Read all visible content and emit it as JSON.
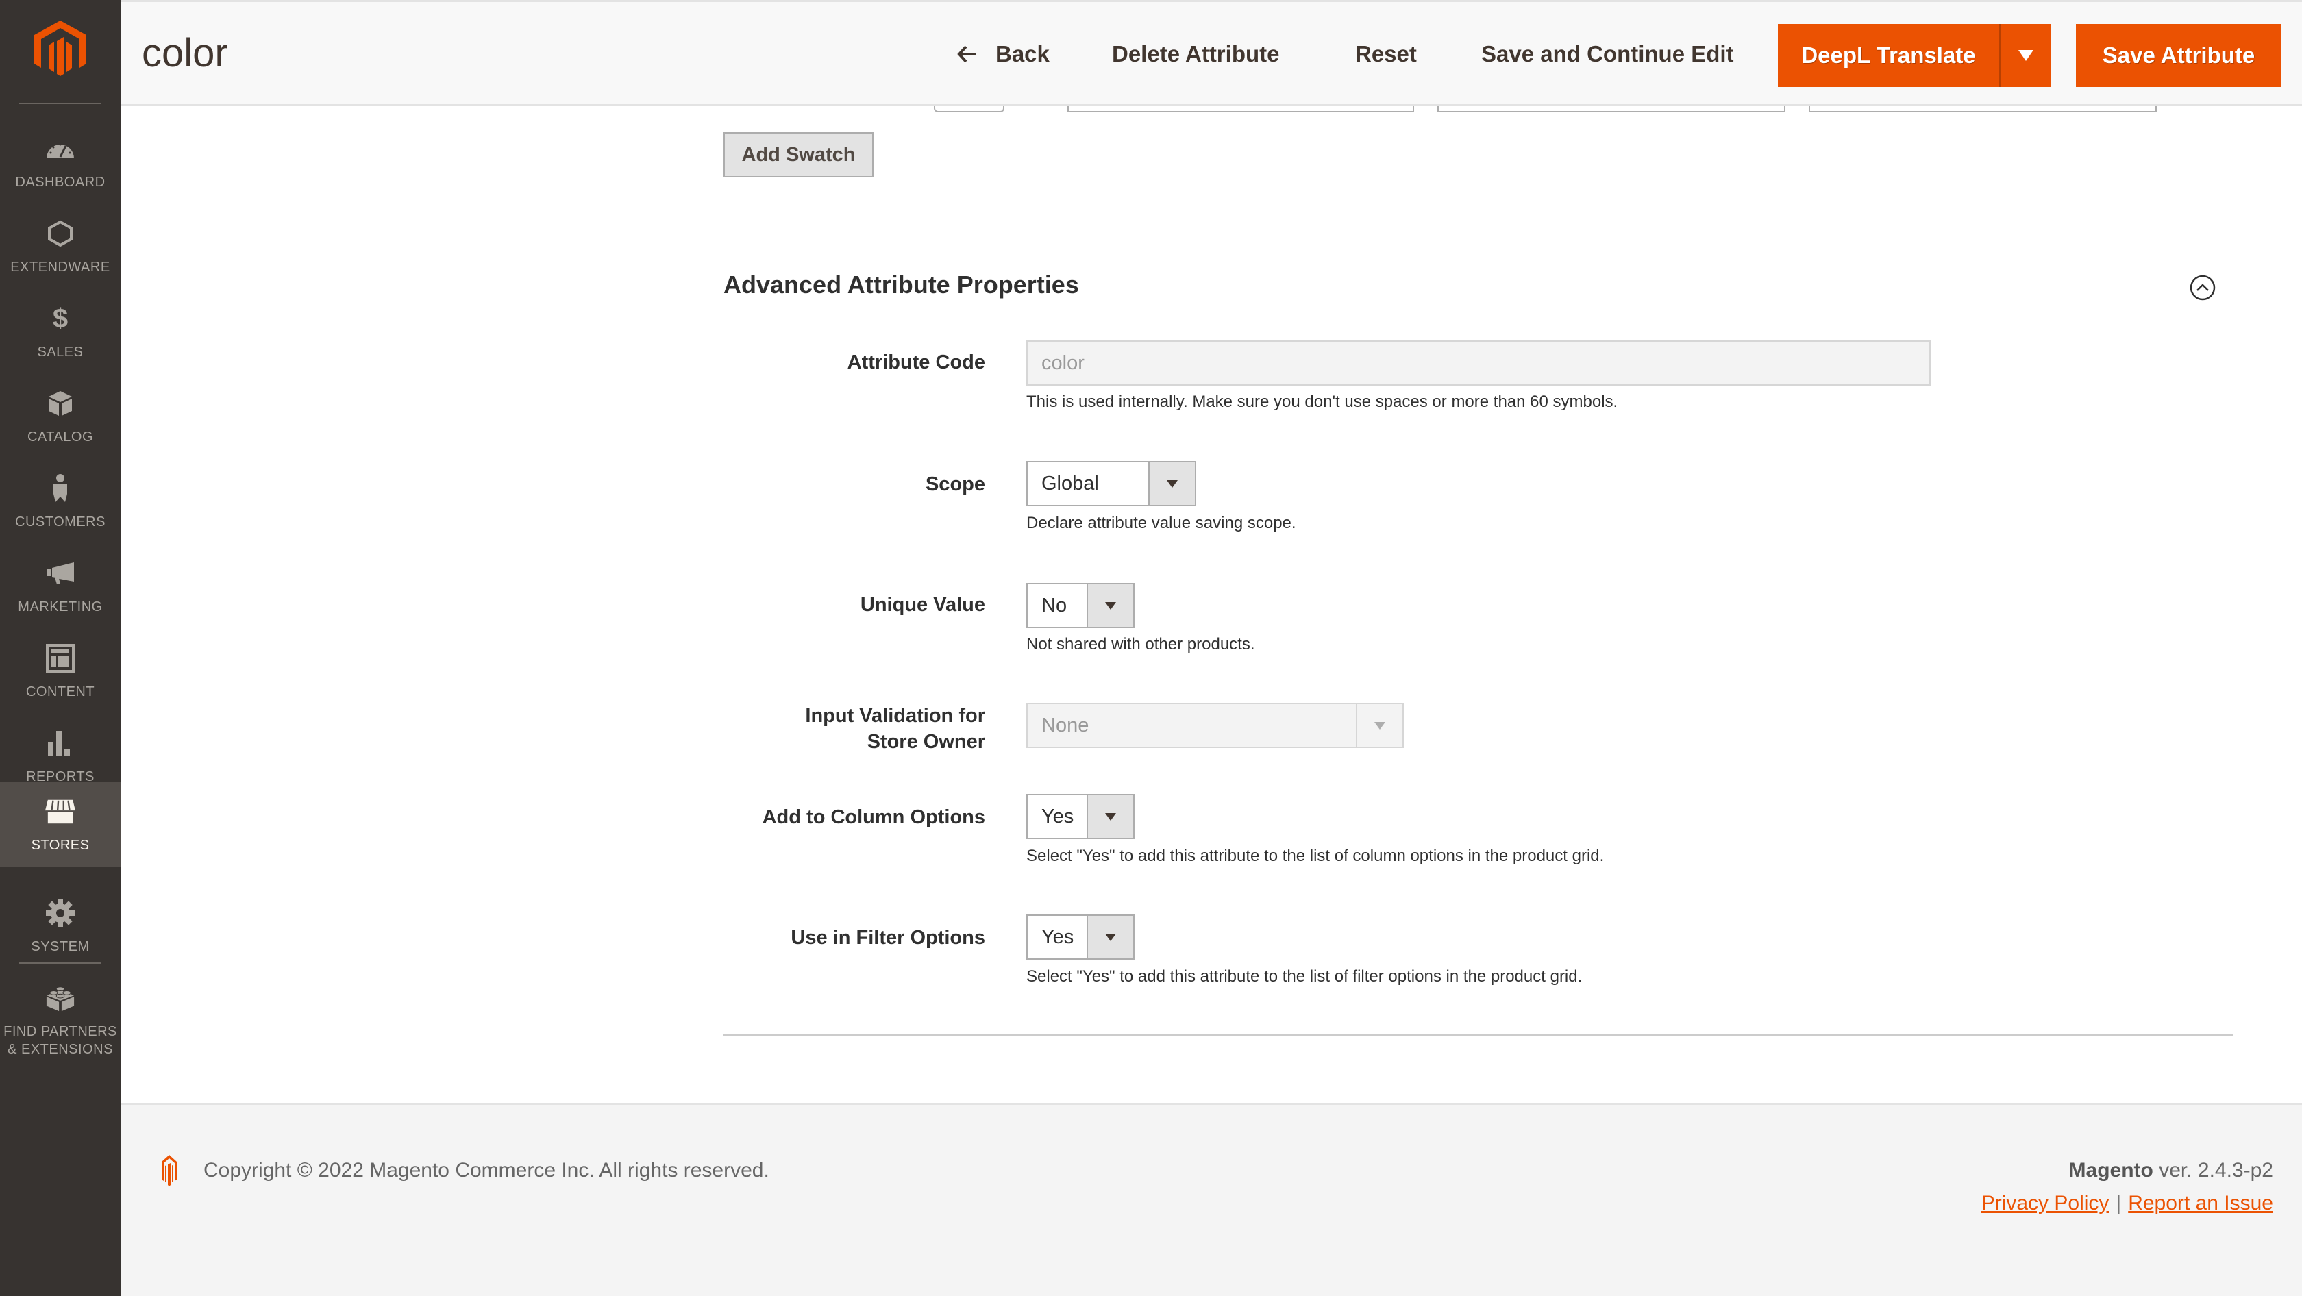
{
  "sidebar": {
    "logo": "magento-logo",
    "items": [
      {
        "label": "Dashboard",
        "icon": "dashboard-icon"
      },
      {
        "label": "Extendware",
        "icon": "hexagon-icon"
      },
      {
        "label": "Sales",
        "icon": "dollar-icon"
      },
      {
        "label": "Catalog",
        "icon": "box-icon"
      },
      {
        "label": "Customers",
        "icon": "person-icon"
      },
      {
        "label": "Marketing",
        "icon": "megaphone-icon"
      },
      {
        "label": "Content",
        "icon": "layout-icon"
      },
      {
        "label": "Reports",
        "icon": "bar-chart-icon"
      },
      {
        "label": "Stores",
        "icon": "store-icon",
        "active": true
      },
      {
        "label": "System",
        "icon": "gear-icon"
      },
      {
        "label_line1": "Find Partners",
        "label_line2": "& Extensions",
        "icon": "lego-block-icon"
      }
    ]
  },
  "header": {
    "title": "color",
    "back_label": "Back",
    "delete_label": "Delete Attribute",
    "reset_label": "Reset",
    "save_continue_label": "Save and Continue Edit",
    "deepl_label": "DeepL Translate",
    "save_label": "Save Attribute"
  },
  "colors": {
    "accent": "#eb5202",
    "sidebar_bg": "#373330",
    "sidebar_active": "#524d49"
  },
  "swatch": {
    "add_label": "Add Swatch"
  },
  "advanced": {
    "title": "Advanced Attribute Properties",
    "fields": {
      "attribute_code": {
        "label": "Attribute Code",
        "value": "color",
        "note": "This is used internally. Make sure you don't use spaces or more than 60 symbols."
      },
      "scope": {
        "label": "Scope",
        "value": "Global",
        "note": "Declare attribute value saving scope."
      },
      "unique_value": {
        "label": "Unique Value",
        "value": "No",
        "note": "Not shared with other products."
      },
      "input_validation": {
        "label_line1": "Input Validation for",
        "label_line2": "Store Owner",
        "value": "None"
      },
      "add_to_column": {
        "label": "Add to Column Options",
        "value": "Yes",
        "note": "Select \"Yes\" to add this attribute to the list of column options in the product grid."
      },
      "use_in_filter": {
        "label": "Use in Filter Options",
        "value": "Yes",
        "note": "Select \"Yes\" to add this attribute to the list of filter options in the product grid."
      }
    }
  },
  "footer": {
    "copyright": "Copyright © 2022 Magento Commerce Inc. All rights reserved.",
    "brand": "Magento",
    "version": "ver. 2.4.3-p2",
    "privacy_label": "Privacy Policy",
    "separator": "|",
    "report_label": "Report an Issue"
  }
}
